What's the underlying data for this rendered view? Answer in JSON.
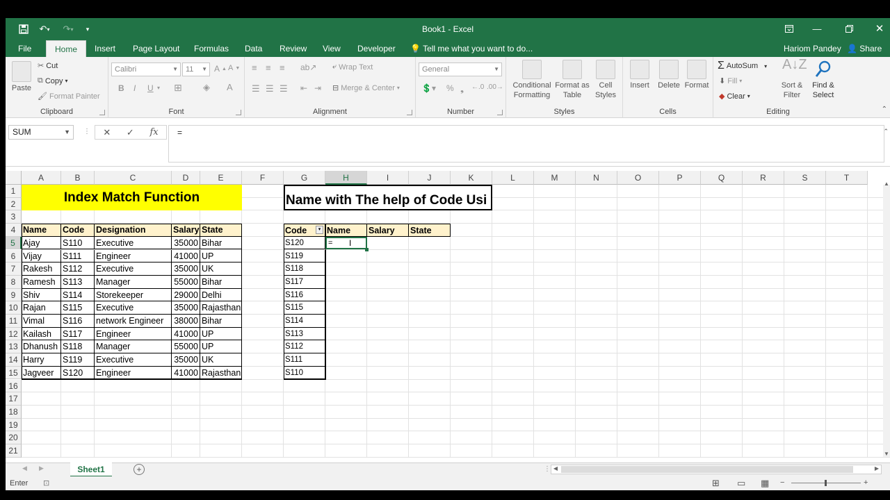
{
  "window": {
    "title": "Book1 - Excel"
  },
  "quick_access": {
    "save_icon": "save-icon",
    "undo_icon": "undo-icon",
    "redo_icon": "redo-icon",
    "customize_icon": "customize-qat-icon"
  },
  "tabs": [
    "File",
    "Home",
    "Insert",
    "Page Layout",
    "Formulas",
    "Data",
    "Review",
    "View",
    "Developer"
  ],
  "active_tab": "Home",
  "tell_me": "Tell me what you want to do...",
  "user": "Hariom Pandey",
  "share": "Share",
  "ribbon": {
    "clipboard": {
      "label": "Clipboard",
      "paste": "Paste",
      "cut": "Cut",
      "copy": "Copy",
      "format_painter": "Format Painter"
    },
    "font": {
      "label": "Font",
      "font_name": "Calibri",
      "font_size": "11",
      "bold": "B",
      "italic": "I",
      "underline": "U"
    },
    "alignment": {
      "label": "Alignment",
      "wrap_text": "Wrap Text",
      "merge_center": "Merge & Center"
    },
    "number": {
      "label": "Number",
      "format": "General",
      "percent": "%"
    },
    "styles": {
      "label": "Styles",
      "conditional": "Conditional Formatting",
      "format_table": "Format as Table",
      "cell_styles": "Cell Styles"
    },
    "cells": {
      "label": "Cells",
      "insert": "Insert",
      "delete": "Delete",
      "format": "Format"
    },
    "editing": {
      "label": "Editing",
      "autosum": "AutoSum",
      "fill": "Fill",
      "clear": "Clear",
      "sort_filter": "Sort & Filter",
      "find_select": "Find & Select"
    }
  },
  "formula_bar": {
    "name_box": "SUM",
    "formula": "="
  },
  "columns": [
    "A",
    "B",
    "C",
    "D",
    "E",
    "F",
    "G",
    "H",
    "I",
    "J",
    "K",
    "L",
    "M",
    "N",
    "O",
    "P",
    "Q",
    "R",
    "S",
    "T"
  ],
  "rows": [
    "1",
    "2",
    "3",
    "4",
    "5",
    "6",
    "7",
    "8",
    "9",
    "10",
    "11",
    "12",
    "13",
    "14",
    "15",
    "16",
    "17",
    "18",
    "19",
    "20",
    "21"
  ],
  "title_left": "Index Match Function",
  "title_right": "Name with The help of Code Usi",
  "main_table": {
    "headers": [
      "Name",
      "Code",
      "Designation",
      "Salary",
      "State"
    ],
    "rows": [
      [
        "Ajay",
        "S110",
        "Executive",
        "35000",
        "Bihar"
      ],
      [
        "Vijay",
        "S111",
        "Engineer",
        "41000",
        "UP"
      ],
      [
        "Rakesh",
        "S112",
        "Executive",
        "35000",
        "UK"
      ],
      [
        "Ramesh",
        "S113",
        "Manager",
        "55000",
        "Bihar"
      ],
      [
        "Shiv",
        "S114",
        "Storekeeper",
        "29000",
        "Delhi"
      ],
      [
        "Rajan",
        "S115",
        "Executive",
        "35000",
        "Rajasthan"
      ],
      [
        "Vimal",
        "S116",
        "network Engineer",
        "38000",
        "Bihar"
      ],
      [
        "Kailash",
        "S117",
        "Engineer",
        "41000",
        "UP"
      ],
      [
        "Dhanush",
        "S118",
        "Manager",
        "55000",
        "UP"
      ],
      [
        "Harry",
        "S119",
        "Executive",
        "35000",
        "UK"
      ],
      [
        "Jagveer",
        "S120",
        "Engineer",
        "41000",
        "Rajasthan"
      ]
    ]
  },
  "lookup_table": {
    "headers": [
      "Code",
      "Name",
      "Salary",
      "State"
    ],
    "codes": [
      "S120",
      "S119",
      "S118",
      "S117",
      "S116",
      "S115",
      "S114",
      "S113",
      "S112",
      "S111",
      "S110"
    ],
    "active_value": "="
  },
  "sheets": [
    "Sheet1"
  ],
  "status": {
    "mode": "Enter"
  }
}
